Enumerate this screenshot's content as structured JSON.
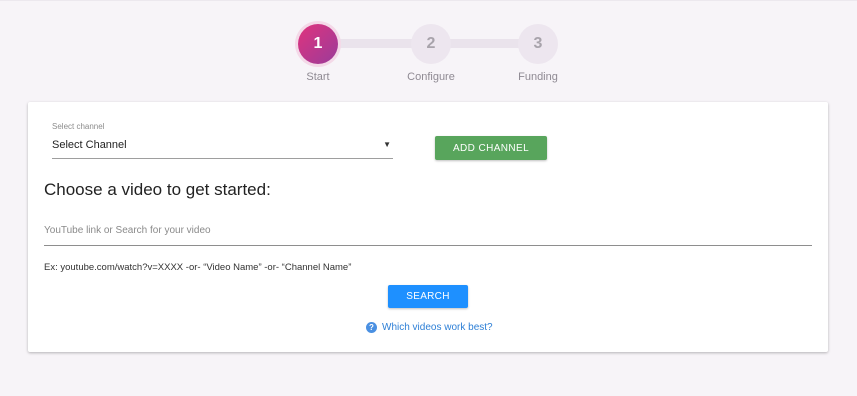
{
  "stepper": {
    "steps": [
      {
        "number": "1",
        "label": "Start",
        "active": true
      },
      {
        "number": "2",
        "label": "Configure",
        "active": false
      },
      {
        "number": "3",
        "label": "Funding",
        "active": false
      }
    ]
  },
  "channel": {
    "label": "Select channel",
    "selected": "Select Channel",
    "caret": "▼"
  },
  "add_channel_label": "ADD CHANNEL",
  "heading": "Choose a video to get started:",
  "search": {
    "placeholder": "YouTube link or Search for your video",
    "value": ""
  },
  "hint": "Ex: youtube.com/watch?v=XXXX -or- “Video Name” -or- “Channel Name”",
  "search_button_label": "SEARCH",
  "help": {
    "icon": "?",
    "text": "Which videos work best?"
  },
  "colors": {
    "accent_gradient_start": "#e0337d",
    "accent_gradient_end": "#9a3c9a",
    "add_channel_green": "#58a55c",
    "search_blue": "#1e90ff",
    "link_blue": "#2d7fd6"
  }
}
